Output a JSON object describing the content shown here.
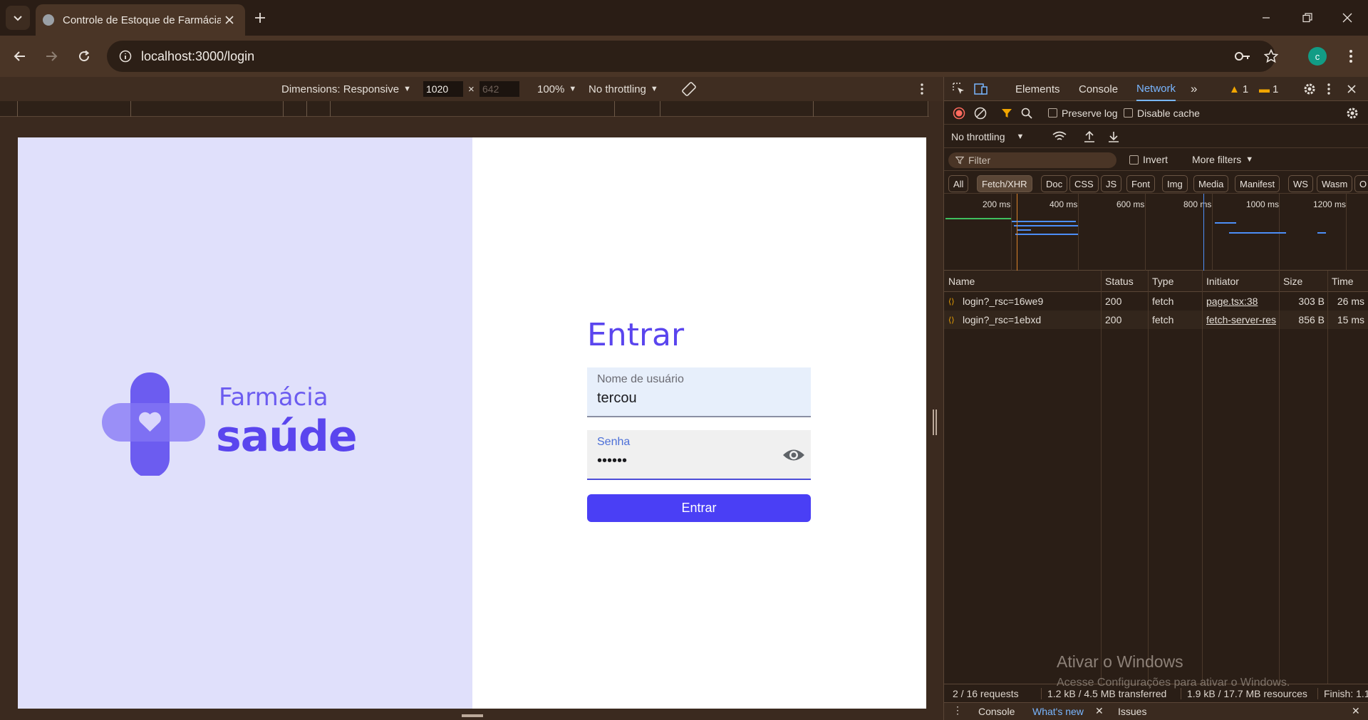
{
  "browser": {
    "tab_title": "Controle de Estoque de Farmácia",
    "url": "localhost:3000/login",
    "profile_initial": "c"
  },
  "device_toolbar": {
    "dimensions_label": "Dimensions: Responsive",
    "width": "1020",
    "height_placeholder": "642",
    "times": "×",
    "zoom": "100%",
    "throttling": "No throttling"
  },
  "page": {
    "logo_line1": "Farmácia",
    "logo_line2": "saúde",
    "heading": "Entrar",
    "username_label": "Nome de usuário",
    "username_value": "tercou",
    "password_label": "Senha",
    "password_value": "••••••",
    "submit_label": "Entrar",
    "colors": {
      "accent": "#4a3ff5",
      "left_panel": "#e0e0fb",
      "logo": "#5a45ee"
    }
  },
  "devtools": {
    "tabs": [
      "Elements",
      "Console",
      "Network"
    ],
    "active_tab": "Network",
    "warnings_count": "1",
    "messages_count": "1",
    "preserve_log": "Preserve log",
    "disable_cache": "Disable cache",
    "throttling": "No throttling",
    "filter_placeholder": "Filter",
    "invert": "Invert",
    "more_filters": "More filters",
    "chips": [
      "All",
      "Fetch/XHR",
      "Doc",
      "CSS",
      "JS",
      "Font",
      "Img",
      "Media",
      "Manifest",
      "WS",
      "Wasm",
      "O"
    ],
    "active_chip": "Fetch/XHR",
    "timeline_labels": [
      "200 ms",
      "400 ms",
      "600 ms",
      "800 ms",
      "1000 ms",
      "1200 ms"
    ],
    "columns": [
      "Name",
      "Status",
      "Type",
      "Initiator",
      "Size",
      "Time"
    ],
    "requests": [
      {
        "name": "login?_rsc=16we9",
        "status": "200",
        "type": "fetch",
        "initiator": "page.tsx:38",
        "size": "303 B",
        "time": "26 ms"
      },
      {
        "name": "login?_rsc=1ebxd",
        "status": "200",
        "type": "fetch",
        "initiator": "fetch-server-res",
        "size": "856 B",
        "time": "15 ms"
      }
    ],
    "status": {
      "requests": "2 / 16 requests",
      "transferred": "1.2 kB / 4.5 MB transferred",
      "resources": "1.9 kB / 17.7 MB resources",
      "finish": "Finish: 1.1"
    },
    "drawer_tabs": [
      "Console",
      "What's new",
      "Issues"
    ]
  },
  "watermark": {
    "line1": "Ativar o Windows",
    "line2": "Acesse Configurações para ativar o Windows."
  }
}
